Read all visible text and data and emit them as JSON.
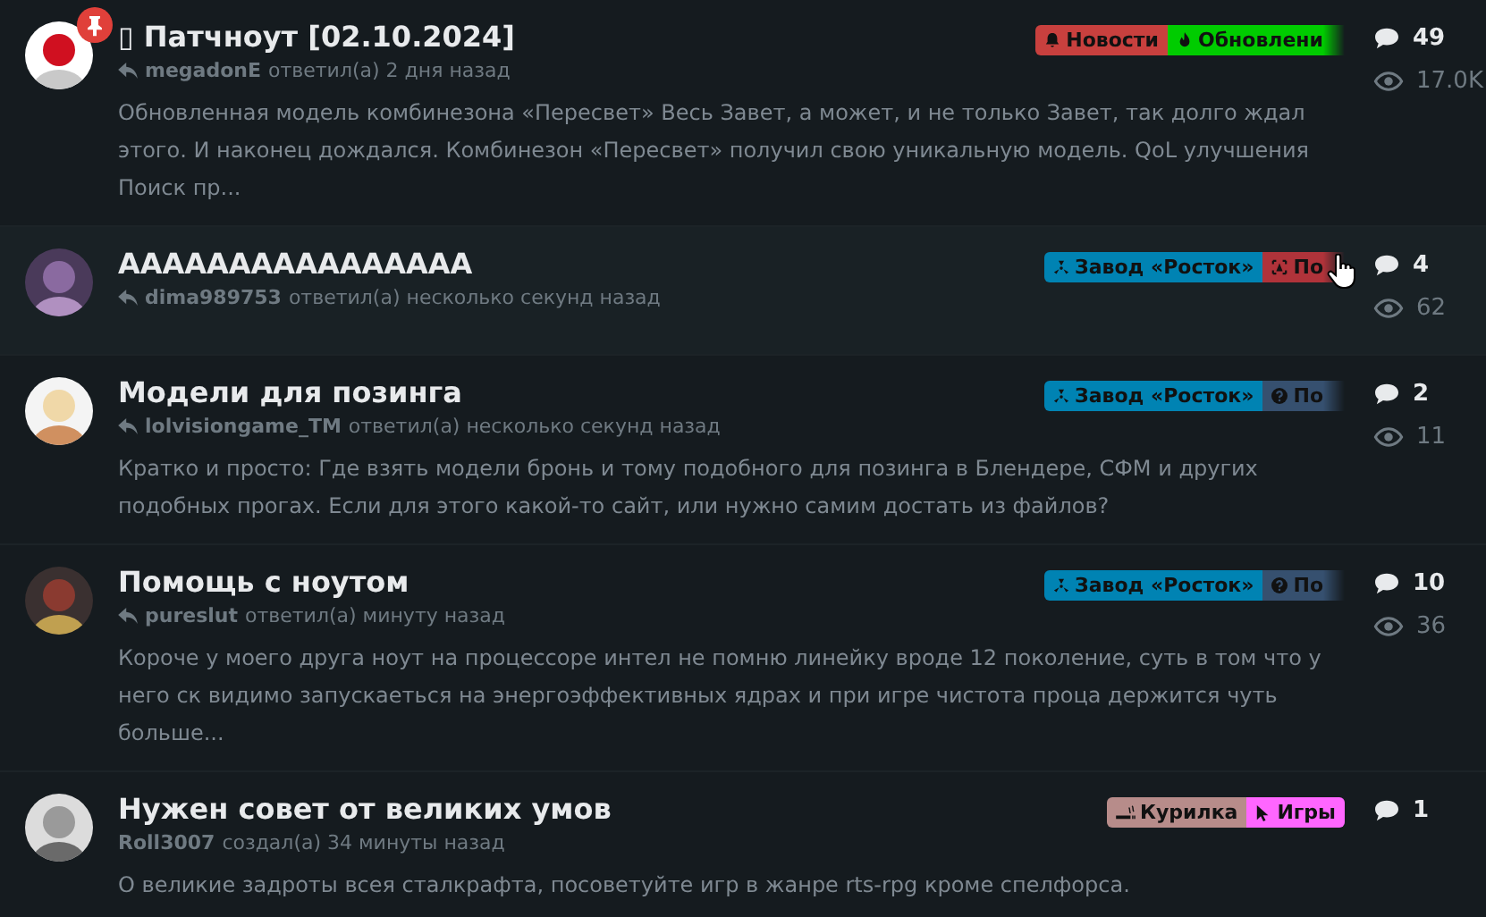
{
  "topics": [
    {
      "title": "▯ Патчноут [02.10.2024]",
      "pinned": true,
      "hovered": false,
      "replied": true,
      "author": "megadonE",
      "action": "ответил(а) 2 дня назад",
      "excerpt": "Обновленная модель комбинезона «Пересвет» Весь Завет, а может, и не только Завет, так долго ждал этого. И наконец дождался. Комбинезон «Пересвет» получил свою уникальную модель. QoL улучшения Поиск пр...",
      "tags": [
        {
          "label": "Новости",
          "kind": "bell",
          "color": "#c8403e",
          "cut": false
        },
        {
          "label": "Обновлени",
          "kind": "fire",
          "color": "#00cc00",
          "cut": true
        }
      ],
      "replies": "49",
      "views": "17.0K"
    },
    {
      "title": "АААААААААААААААА",
      "pinned": false,
      "hovered": true,
      "replied": true,
      "author": "dima989753",
      "action": "ответил(а) несколько секунд назад",
      "tags": [
        {
          "label": "Завод «Росток»",
          "kind": "radiation",
          "color": "#0083b3",
          "cut": false
        },
        {
          "label": "По",
          "kind": "alert",
          "color": "#b0333a",
          "cut": true
        }
      ],
      "replies": "4",
      "views": "62"
    },
    {
      "title": "Модели для позинга",
      "pinned": false,
      "hovered": false,
      "replied": true,
      "author": "lolvisiongame_TM",
      "action": "ответил(а) несколько секунд назад",
      "excerpt": "Кратко и просто: Где взять модели бронь и тому подобного для позинга в Блендере, СФМ и других подобных прогах. Если для этого какой-то сайт, или нужно самим достать из файлов?",
      "tags": [
        {
          "label": "Завод «Росток»",
          "kind": "radiation",
          "color": "#0083b3",
          "cut": false
        },
        {
          "label": "По",
          "kind": "question",
          "color": "#36506f",
          "cut": true
        }
      ],
      "replies": "2",
      "views": "11"
    },
    {
      "title": "Помощь с ноутом",
      "pinned": false,
      "hovered": false,
      "replied": true,
      "author": "pureslut",
      "action": "ответил(а) минуту назад",
      "excerpt": "Короче у моего друга ноут на процессоре интел не помню линейку вроде 12 поколение, суть в том что у него ск видимо запускаеться на энергоэффективных ядрах и при игре чистота проца держится чуть больше...",
      "tags": [
        {
          "label": "Завод «Росток»",
          "kind": "radiation",
          "color": "#0083b3",
          "cut": false
        },
        {
          "label": "По",
          "kind": "question",
          "color": "#36506f",
          "cut": true
        }
      ],
      "replies": "10",
      "views": "36"
    },
    {
      "title": "Нужен совет от великих умов",
      "pinned": false,
      "hovered": false,
      "replied": false,
      "author": "Roll3007",
      "action": "создал(а) 34 минуты назад",
      "excerpt": "О великие задроты всея сталкрафта, посоветуйте игр в жанре rts-rpg кроме спелфорса.",
      "tags": [
        {
          "label": "Курилка",
          "kind": "smoke",
          "color": "#b78c8a",
          "cut": false
        },
        {
          "label": "Игры",
          "kind": "cursor",
          "color": "#ff66ff",
          "cut": false
        }
      ],
      "replies": "1"
    }
  ]
}
